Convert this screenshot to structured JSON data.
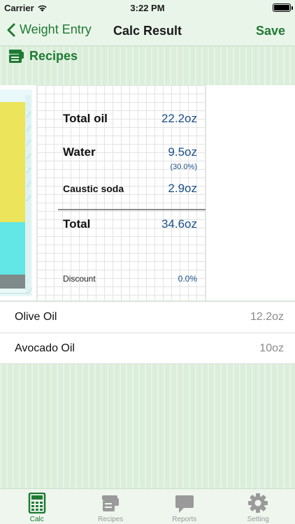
{
  "status_bar": {
    "carrier": "Carrier",
    "time": "3:22 PM"
  },
  "nav": {
    "back_label": "Weight Entry",
    "title": "Calc Result",
    "save_label": "Save"
  },
  "section": {
    "title": "Recipes"
  },
  "results": {
    "total_oil_label": "Total oil",
    "total_oil_value": "22.2oz",
    "water_label": "Water",
    "water_value": "9.5oz",
    "water_percent": "(30.0%)",
    "caustic_label": "Caustic soda",
    "caustic_value": "2.9oz",
    "total_label": "Total",
    "total_value": "34.6oz",
    "discount_label": "Discount",
    "discount_value": "0.0%"
  },
  "oils": [
    {
      "name": "Olive Oil",
      "amount": "12.2oz"
    },
    {
      "name": "Avocado Oil",
      "amount": "10oz"
    }
  ],
  "tabs": [
    {
      "label": "Calc",
      "icon": "calculator-icon",
      "active": true
    },
    {
      "label": "Recipes",
      "icon": "recipe-scroll-icon",
      "active": false
    },
    {
      "label": "Reports",
      "icon": "speech-bubble-icon",
      "active": false
    },
    {
      "label": "Setting",
      "icon": "gear-icon",
      "active": false
    }
  ],
  "colors": {
    "accent": "#1f7a33",
    "value_blue": "#1b4f8a",
    "oil_layer": "#ece45a",
    "water_layer": "#63e6e6",
    "caustic_layer": "#7f8a8a"
  }
}
